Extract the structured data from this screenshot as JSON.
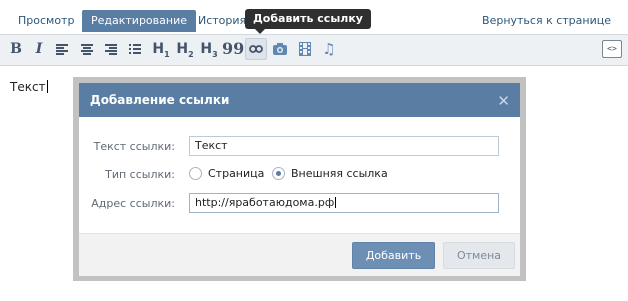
{
  "tabs": [
    {
      "label": "Просмотр"
    },
    {
      "label": "Редактирование"
    },
    {
      "label": "История"
    }
  ],
  "tooltip": "Добавить ссылку",
  "back_link": "Вернуться к странице",
  "toolbar": {
    "bold": "B",
    "italic": "I",
    "h1": "H",
    "h2": "H",
    "h3": "H",
    "sub1": "1",
    "sub2": "2",
    "sub3": "3",
    "quote": "99",
    "source": "<>"
  },
  "editor": {
    "text": "Текст"
  },
  "dialog": {
    "title": "Добавление ссылки",
    "close": "✕",
    "link_text_label": "Текст ссылки:",
    "link_text_value": "Текст",
    "link_type_label": "Тип ссылки:",
    "option_page": "Страница",
    "option_external": "Внешняя ссылка",
    "selected_option": "Внешняя ссылка",
    "url_label": "Адрес ссылки:",
    "url_value": "http://яработаюдома.рф",
    "add_button": "Добавить",
    "cancel_button": "Отмена"
  },
  "colors": {
    "accent": "#597da3",
    "link": "#2b587a",
    "toolbar_bg": "#eef1f4"
  }
}
